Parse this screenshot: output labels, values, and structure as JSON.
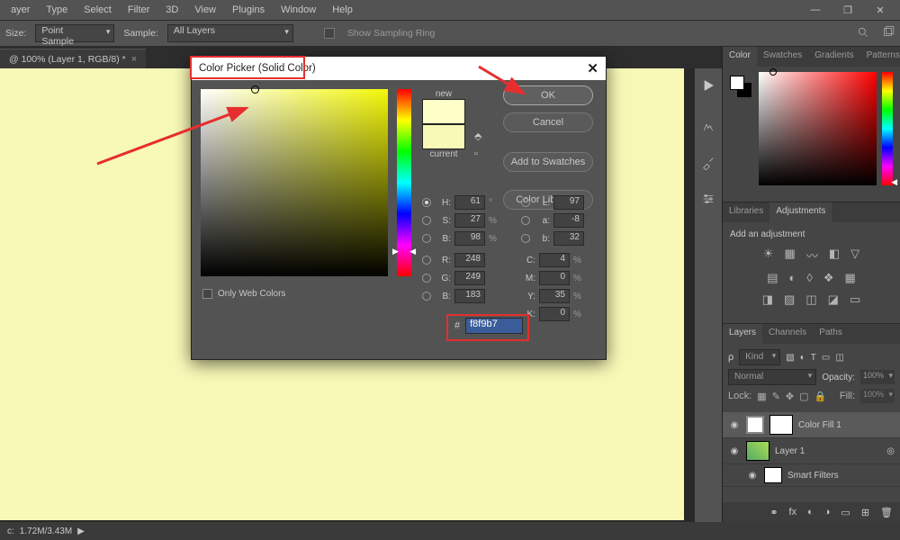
{
  "menu": {
    "items": [
      "ayer",
      "Type",
      "Select",
      "Filter",
      "3D",
      "View",
      "Plugins",
      "Window",
      "Help"
    ]
  },
  "options": {
    "size_label": "Size:",
    "size_value": "Point Sample",
    "sample_label": "Sample:",
    "sample_value": "All Layers",
    "show_ring": "Show Sampling Ring"
  },
  "doc_tab": {
    "title": "@ 100% (Layer 1, RGB/8) *"
  },
  "status": {
    "left": "c:",
    "mem": "1.72M/3.43M",
    "arrow": "▶"
  },
  "panels": {
    "color_tabs": [
      "Color",
      "Swatches",
      "Gradients",
      "Patterns"
    ],
    "lib_tabs": [
      "Libraries",
      "Adjustments"
    ],
    "adjust_hint": "Add an adjustment",
    "layer_tabs": [
      "Layers",
      "Channels",
      "Paths"
    ],
    "kind_label": "Kind",
    "blend": "Normal",
    "opacity_label": "Opacity:",
    "opacity_value": "100%",
    "lock_label": "Lock:",
    "fill_label": "Fill:",
    "fill_value": "100%",
    "layers": [
      {
        "name": "Color Fill 1",
        "selected": true,
        "mask": true
      },
      {
        "name": "Layer 1",
        "selected": false,
        "mask": false
      },
      {
        "name": "Smart Filters",
        "selected": false,
        "indent": true,
        "thumb": "mask"
      }
    ]
  },
  "dialog": {
    "title": "Color Picker (Solid Color)",
    "new_label": "new",
    "current_label": "current",
    "ok": "OK",
    "cancel": "Cancel",
    "add_swatches": "Add to Swatches",
    "libraries": "Color Libraries",
    "only_web": "Only Web Colors",
    "hex_prefix": "#",
    "hex": "f8f9b7",
    "hsb": {
      "H": "61",
      "S": "27",
      "B": "98"
    },
    "lab": {
      "L": "97",
      "a": "-8",
      "b": "32"
    },
    "rgb": {
      "R": "248",
      "G": "249",
      "B": "183"
    },
    "cmyk": {
      "C": "4",
      "M": "0",
      "Y": "35",
      "K": "0"
    },
    "deg": "°",
    "pct": "%"
  },
  "chart_data": null
}
